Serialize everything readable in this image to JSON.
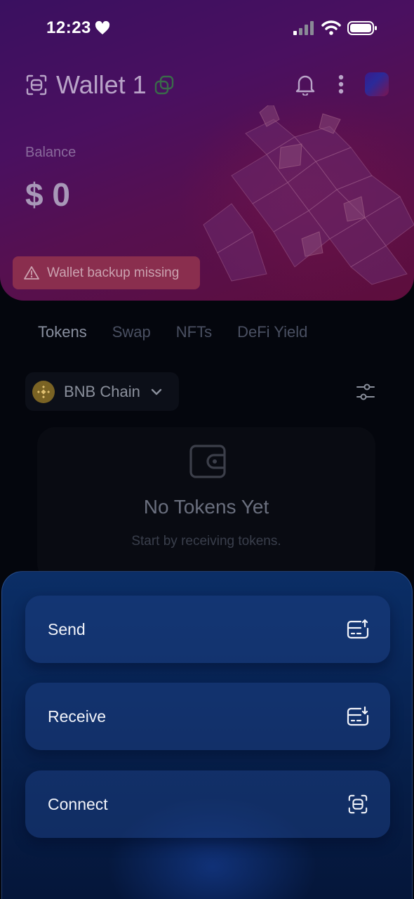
{
  "status_bar": {
    "time": "12:23"
  },
  "header": {
    "wallet_name": "Wallet 1",
    "balance_label": "Balance",
    "balance_value": "$ 0",
    "backup_alert": "Wallet backup missing"
  },
  "tabs": [
    {
      "label": "Tokens",
      "active": true
    },
    {
      "label": "Swap",
      "active": false
    },
    {
      "label": "NFTs",
      "active": false
    },
    {
      "label": "DeFi Yield",
      "active": false
    }
  ],
  "chain_selector": {
    "label": "BNB Chain",
    "icon": "bnb-icon"
  },
  "empty_state": {
    "title": "No Tokens Yet",
    "subtitle": "Start by receiving tokens."
  },
  "actions": [
    {
      "label": "Send",
      "icon": "send-icon"
    },
    {
      "label": "Receive",
      "icon": "receive-icon"
    },
    {
      "label": "Connect",
      "icon": "connect-icon"
    }
  ],
  "colors": {
    "header_gradient_start": "#3a1060",
    "header_gradient_end": "#5e0e3c",
    "alert_background": "#8a2e4e",
    "sheet_background": "#082556",
    "bnb_gold": "#b8902c"
  }
}
